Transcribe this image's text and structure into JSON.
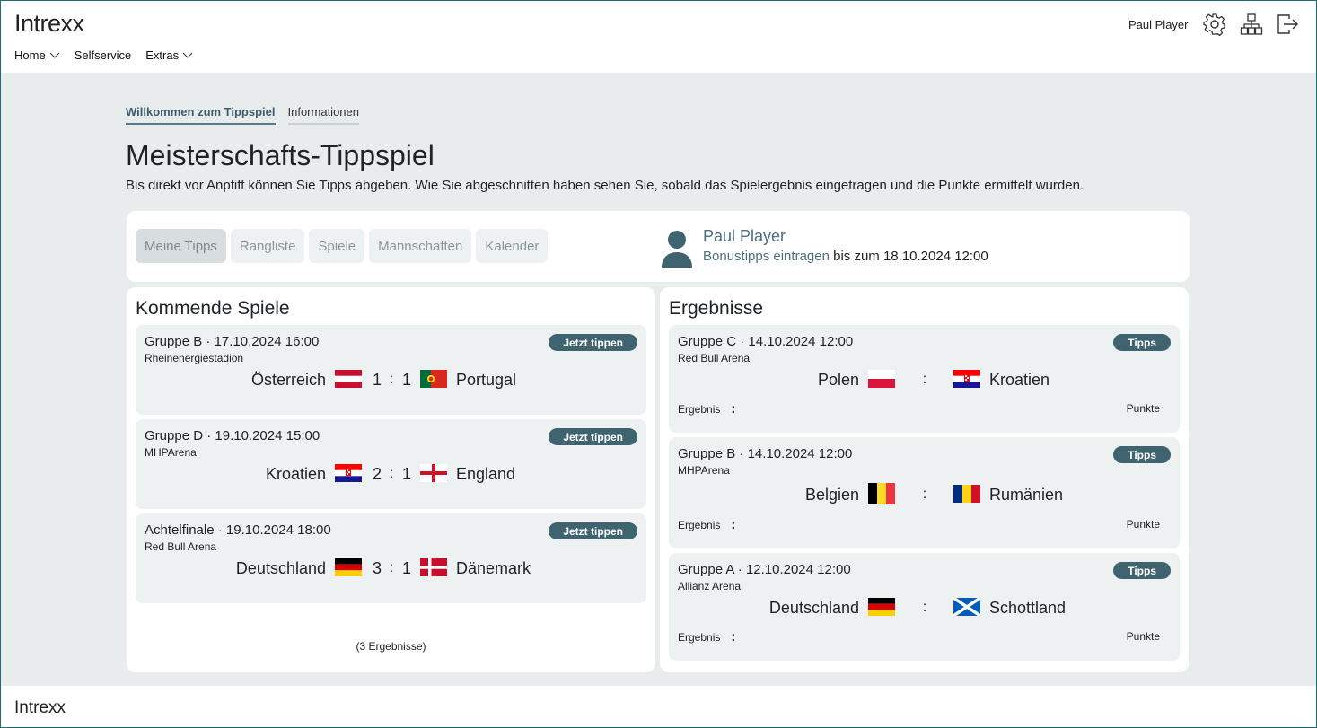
{
  "app": {
    "logo": "Intrexx"
  },
  "nav": [
    {
      "label": "Home",
      "has_menu": true
    },
    {
      "label": "Selfservice",
      "has_menu": false
    },
    {
      "label": "Extras",
      "has_menu": true
    }
  ],
  "header": {
    "user_name": "Paul Player",
    "icons": [
      "gear-icon",
      "sitemap-icon",
      "logout-icon"
    ]
  },
  "tabs": [
    {
      "label": "Willkommen zum Tippspiel",
      "active": true
    },
    {
      "label": "Informationen",
      "active": false
    }
  ],
  "page": {
    "title": "Meisterschafts-Tippspiel",
    "subtitle": "Bis direkt vor Anpfiff können Sie Tipps abgeben. Wie Sie abgeschnitten haben sehen Sie, sobald das Spielergebnis eingetragen und die Punkte ermittelt wurden."
  },
  "segments": [
    {
      "label": "Meine Tipps",
      "active": true
    },
    {
      "label": "Rangliste",
      "active": false
    },
    {
      "label": "Spiele",
      "active": false
    },
    {
      "label": "Mannschaften",
      "active": false
    },
    {
      "label": "Kalender",
      "active": false
    }
  ],
  "profile": {
    "name": "Paul Player",
    "bonus_link": "Bonustipps eintragen",
    "deadline_text": "bis zum",
    "deadline": "18.10.2024 12:00"
  },
  "upcoming": {
    "title": "Kommende Spiele",
    "button_label": "Jetzt tippen",
    "matches": [
      {
        "group": "Gruppe B",
        "datetime": "17.10.2024 16:00",
        "venue": "Rheinenergiestadion",
        "home": "Österreich",
        "home_flag": "austria",
        "away": "Portugal",
        "away_flag": "portugal",
        "score_home": "1",
        "score_away": "1"
      },
      {
        "group": "Gruppe D",
        "datetime": "19.10.2024 15:00",
        "venue": "MHPArena",
        "home": "Kroatien",
        "home_flag": "croatia",
        "away": "England",
        "away_flag": "england",
        "score_home": "2",
        "score_away": "1"
      },
      {
        "group": "Achtelfinale",
        "datetime": "19.10.2024 18:00",
        "venue": "Red Bull Arena",
        "home": "Deutschland",
        "home_flag": "germany",
        "away": "Dänemark",
        "away_flag": "denmark",
        "score_home": "3",
        "score_away": "1"
      }
    ],
    "results_count": "(3 Ergebnisse)"
  },
  "results": {
    "title": "Ergebnisse",
    "button_label": "Tipps",
    "result_label": "Ergebnis",
    "points_label": "Punkte",
    "matches": [
      {
        "group": "Gruppe C",
        "datetime": "14.10.2024 12:00",
        "venue": "Red Bull Arena",
        "home": "Polen",
        "home_flag": "poland",
        "away": "Kroatien",
        "away_flag": "croatia"
      },
      {
        "group": "Gruppe B",
        "datetime": "14.10.2024 12:00",
        "venue": "MHPArena",
        "home": "Belgien",
        "home_flag": "belgium",
        "away": "Rumänien",
        "away_flag": "romania"
      },
      {
        "group": "Gruppe A",
        "datetime": "12.10.2024 12:00",
        "venue": "Allianz Arena",
        "home": "Deutschland",
        "home_flag": "germany",
        "away": "Schottland",
        "away_flag": "scotland"
      }
    ]
  },
  "footer": {
    "logo": "Intrexx"
  },
  "colors": {
    "accent": "#3f6470",
    "background": "#e8ecec",
    "link": "#4f6e80"
  }
}
